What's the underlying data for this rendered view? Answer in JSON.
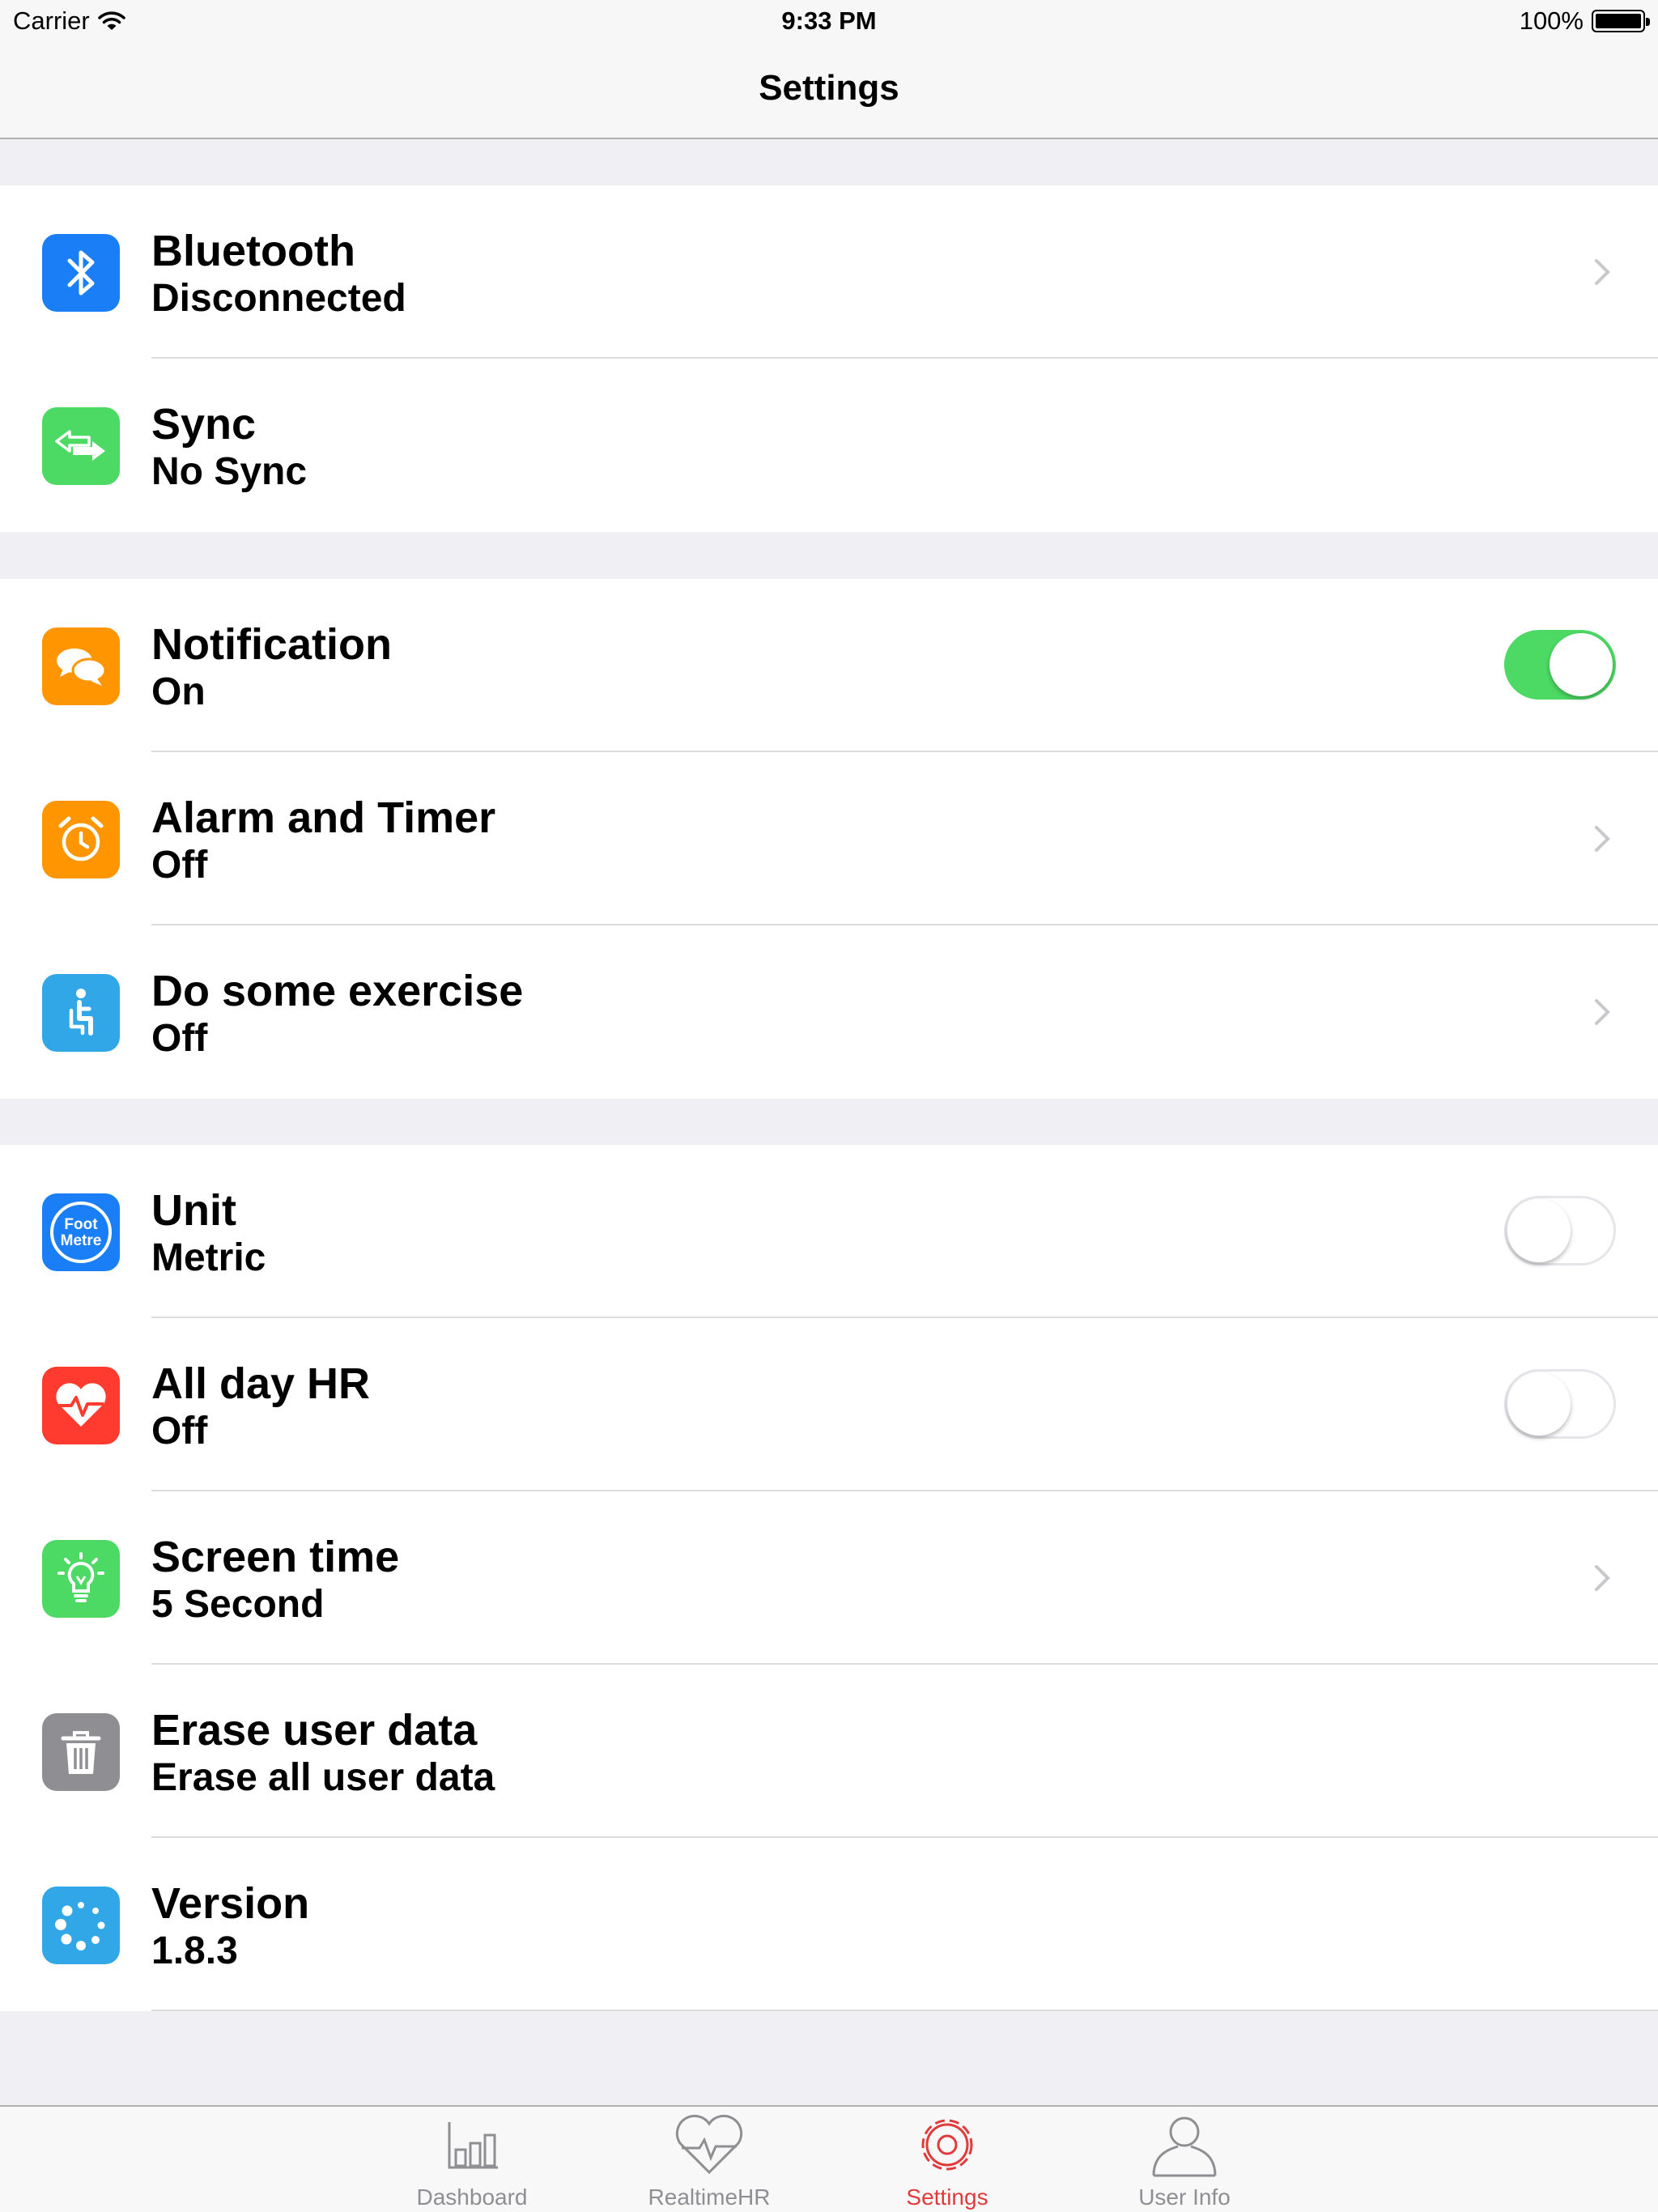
{
  "status_bar": {
    "carrier": "Carrier",
    "time": "9:33 PM",
    "battery": "100%"
  },
  "nav": {
    "title": "Settings"
  },
  "sections": [
    {
      "rows": [
        {
          "title": "Bluetooth",
          "subtitle": "Disconnected",
          "icon": "bluetooth-icon",
          "accessory": "chevron"
        },
        {
          "title": "Sync",
          "subtitle": "No Sync",
          "icon": "sync-arrows-icon",
          "accessory": "none"
        }
      ]
    },
    {
      "rows": [
        {
          "title": "Notification",
          "subtitle": "On",
          "icon": "chat-bubbles-icon",
          "accessory": "toggle",
          "toggle_on": true
        },
        {
          "title": "Alarm and Timer",
          "subtitle": "Off",
          "icon": "alarm-clock-icon",
          "accessory": "chevron"
        },
        {
          "title": "Do some exercise",
          "subtitle": "Off",
          "icon": "seated-person-icon",
          "accessory": "chevron"
        }
      ]
    },
    {
      "rows": [
        {
          "title": "Unit",
          "subtitle": "Metric",
          "icon": "foot-metre-icon",
          "icon_text_1": "Foot",
          "icon_text_2": "Metre",
          "accessory": "toggle",
          "toggle_on": false
        },
        {
          "title": "All day HR",
          "subtitle": "Off",
          "icon": "heart-pulse-icon",
          "accessory": "toggle",
          "toggle_on": false
        },
        {
          "title": "Screen time",
          "subtitle": "5 Second",
          "icon": "light-bulb-icon",
          "accessory": "chevron"
        },
        {
          "title": "Erase user data",
          "subtitle": "Erase all user data",
          "icon": "trash-icon",
          "accessory": "none"
        },
        {
          "title": "Version",
          "subtitle": "1.8.3",
          "icon": "spinner-dots-icon",
          "accessory": "none"
        }
      ]
    }
  ],
  "tabs": [
    {
      "label": "Dashboard",
      "icon": "bar-chart-icon",
      "active": false
    },
    {
      "label": "RealtimeHR",
      "icon": "heart-rate-icon",
      "active": false
    },
    {
      "label": "Settings",
      "icon": "gear-icon",
      "active": true
    },
    {
      "label": "User Info",
      "icon": "user-icon",
      "active": false
    }
  ],
  "colors": {
    "bluetooth": "#1a7ef6",
    "sync": "#4cd964",
    "notification": "#ff9500",
    "alarm": "#ff9500",
    "exercise": "#32a7e8",
    "unit": "#1a7ef6",
    "heart": "#ff3b30",
    "screen": "#4cd964",
    "erase": "#8e8e93",
    "version": "#32a7e8",
    "toggle_on": "#4cd964",
    "tab_active": "#e03a3a"
  }
}
